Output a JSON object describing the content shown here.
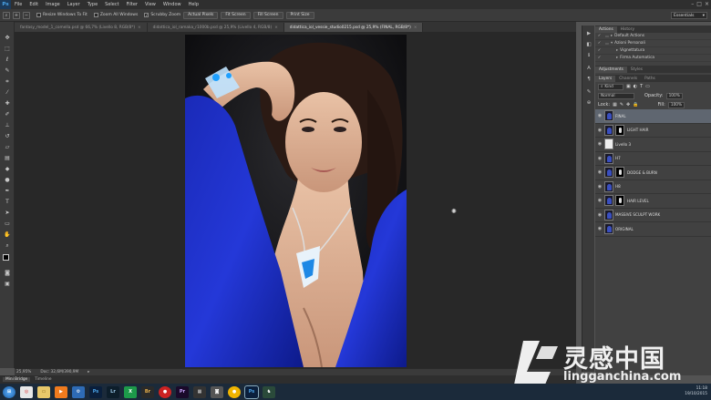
{
  "app": {
    "logo": "Ps"
  },
  "menu": [
    "File",
    "Edit",
    "Image",
    "Layer",
    "Type",
    "Select",
    "Filter",
    "View",
    "Window",
    "Help"
  ],
  "options": {
    "resize_windows": "Resize Windows To Fit",
    "zoom_all": "Zoom All Windows",
    "scrubby_zoom": "Scrubby Zoom",
    "actual_pixels": "Actual Pixels",
    "fit_screen": "Fit Screen",
    "fill_screen": "Fill Screen",
    "print_size": "Print Size"
  },
  "workspace": "Essentials",
  "tabs": [
    "fantasy_model_1_comella.psd @ 66,7% (Livello 8, RGB/8*)",
    "didattica_iol_ramaka_r1000b.psd @ 25,9% (Livello 4, RGB/8)",
    "didattica_iol_vessie_studio0215.psd @ 25,9% (FINAL, RGB/8*)"
  ],
  "status": {
    "zoom": "25,95%",
    "doc": "Doc: 32,6M/390,9M"
  },
  "mini_tabs": [
    "Mini Bridge",
    "Timeline"
  ],
  "actions_panel": {
    "tabs": [
      "Actions",
      "History"
    ],
    "rows": [
      "Default Actions",
      "Azioni Personali",
      "Vignettatura",
      "Firma Automatica"
    ]
  },
  "adjust_tabs": [
    "Adjustments",
    "Styles"
  ],
  "layers_panel": {
    "tabs": [
      "Layers",
      "Channels",
      "Paths"
    ],
    "kind": "Kind",
    "blend_mode": "Normal",
    "opacity_label": "Opacity:",
    "opacity": "100%",
    "lock_label": "Lock:",
    "fill_label": "Fill:",
    "fill": "100%",
    "layers": [
      {
        "name": "FINAL",
        "type": "thumb",
        "selected": true
      },
      {
        "name": "LIGHT HAIR",
        "type": "mask"
      },
      {
        "name": "Livello 3",
        "type": "blank"
      },
      {
        "name": "H7",
        "type": "thumb"
      },
      {
        "name": "DODGE & BURN",
        "type": "mask"
      },
      {
        "name": "H8",
        "type": "thumb"
      },
      {
        "name": "HAIR LEVEL",
        "type": "mask"
      },
      {
        "name": "MASSIVE SCULPT WORK",
        "type": "thumb"
      },
      {
        "name": "ORIGINAL",
        "type": "thumb"
      }
    ]
  },
  "watermark": {
    "cn": "灵感中国",
    "en": "lingganchina.com"
  },
  "taskbar": {
    "apps": [
      "Ps",
      "Lr",
      "Br",
      "Pr",
      "Ps"
    ],
    "time": "11:18",
    "date": "19/10/2015"
  },
  "colors": {
    "accent": "#4aa3e8",
    "selected_layer": "#5f6670",
    "dress": "#1f33c9"
  }
}
